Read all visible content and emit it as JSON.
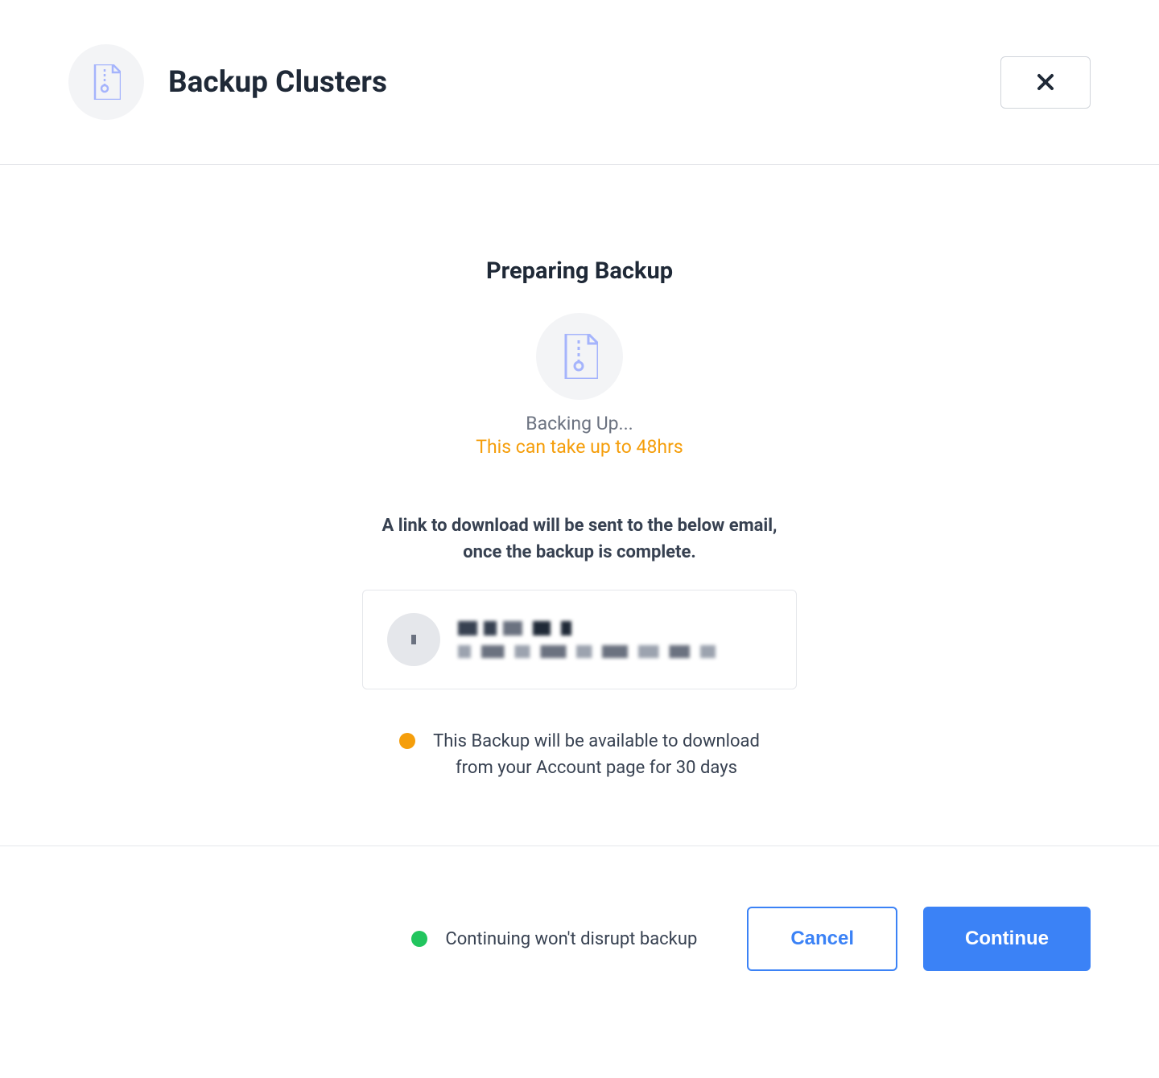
{
  "header": {
    "title": "Backup Clusters"
  },
  "content": {
    "section_title": "Preparing Backup",
    "status_text": "Backing Up...",
    "duration_text": "This can take up to 48hrs",
    "description_line1": "A link to download will be sent to the below email,",
    "description_line2": "once the backup is complete.",
    "info_line1": "This Backup will be available to download",
    "info_line2": "from your Account page for 30 days"
  },
  "footer": {
    "status_text": "Continuing won't disrupt backup",
    "cancel_label": "Cancel",
    "continue_label": "Continue"
  }
}
